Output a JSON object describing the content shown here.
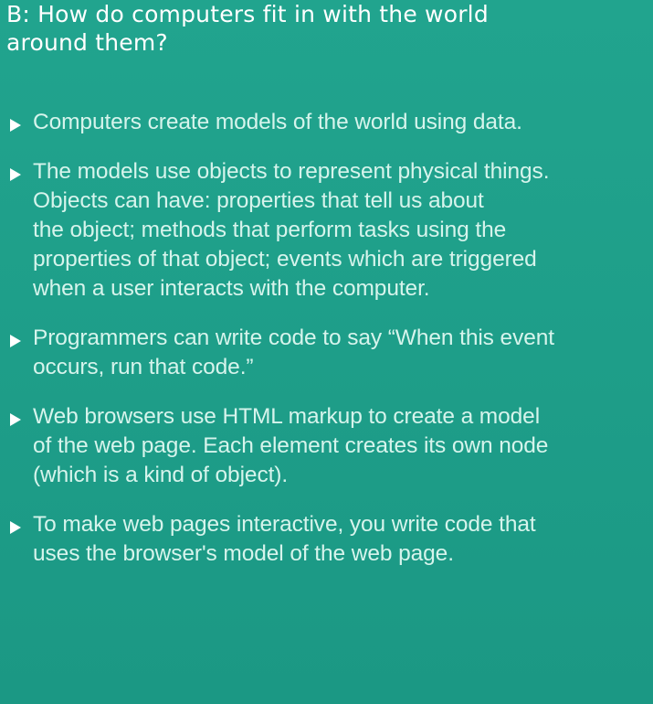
{
  "heading": "B: How do computers fit in with the world\naround them?",
  "bullets": [
    {
      "text": "Computers create models of the world using data."
    },
    {
      "text": "The models use objects to represent physical things.\nObjects can have: properties that tell us about\nthe object; methods that perform tasks using the\nproperties of that object; events which are triggered\nwhen a user interacts with the computer."
    },
    {
      "text": "Programmers can write code to say “When this event\noccurs, run that code.”"
    },
    {
      "text": "Web browsers use HTML markup to create a model\nof the web page. Each element creates its own node\n(which is a kind of object)."
    },
    {
      "text": "To make web pages interactive, you write code that\nuses the browser's model of the web page."
    }
  ],
  "colors": {
    "background": "#1fa08b",
    "heading": "#ffffff",
    "bullet_text": "#d6f4ec",
    "bullet_icon": "#ffffff"
  },
  "icons": {
    "bullet": "triangle-right-icon"
  }
}
